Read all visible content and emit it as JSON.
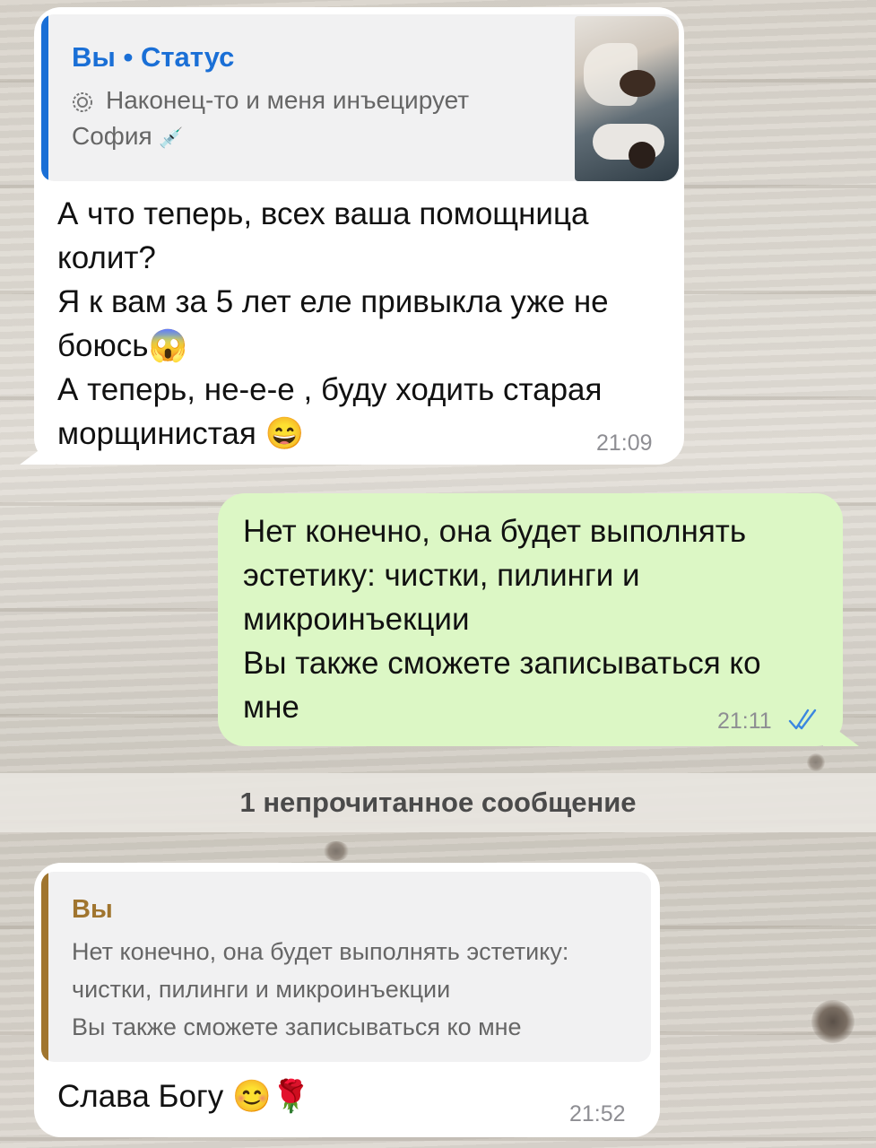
{
  "messages": [
    {
      "direction": "incoming",
      "reply": {
        "author": "Вы • Статус",
        "line1": "Наконец-то и меня инъецирует",
        "line2": "София",
        "icon": "status-icon",
        "emoji": "💉"
      },
      "text": "А что теперь, всех ваша помощница\nколит?\nЯ к вам за 5 лет еле привыкла уже не\nбоюсь😱\nА теперь, не-е-е , буду ходить старая\nморщинистая 😄",
      "time": "21:09"
    },
    {
      "direction": "outgoing",
      "text": "Нет конечно, она будет выполнять\nэстетику: чистки, пилинги и\nмикроинъекции\nВы также сможете записываться ко\nмне",
      "time": "21:11",
      "status_icon": "double-check-icon"
    }
  ],
  "unread_divider": "1 непрочитанное сообщение",
  "last_message": {
    "direction": "incoming",
    "reply": {
      "author": "Вы",
      "text": "Нет конечно, она будет выполнять эстетику:\nчистки, пилинги и микроинъекции\nВы также сможете записываться ко мне"
    },
    "text": "Слава Богу 😊🌹",
    "time": "21:52"
  },
  "colors": {
    "incoming_bubble": "#ffffff",
    "outgoing_bubble": "#dcf7c5",
    "status_quote_bar": "#1a6fd6",
    "status_author": "#1a6fd6",
    "reply_quote_bar": "#a0752f",
    "reply_author": "#a0752f",
    "check_marks": "#3a87e0",
    "timestamp": "#8e8e93"
  }
}
